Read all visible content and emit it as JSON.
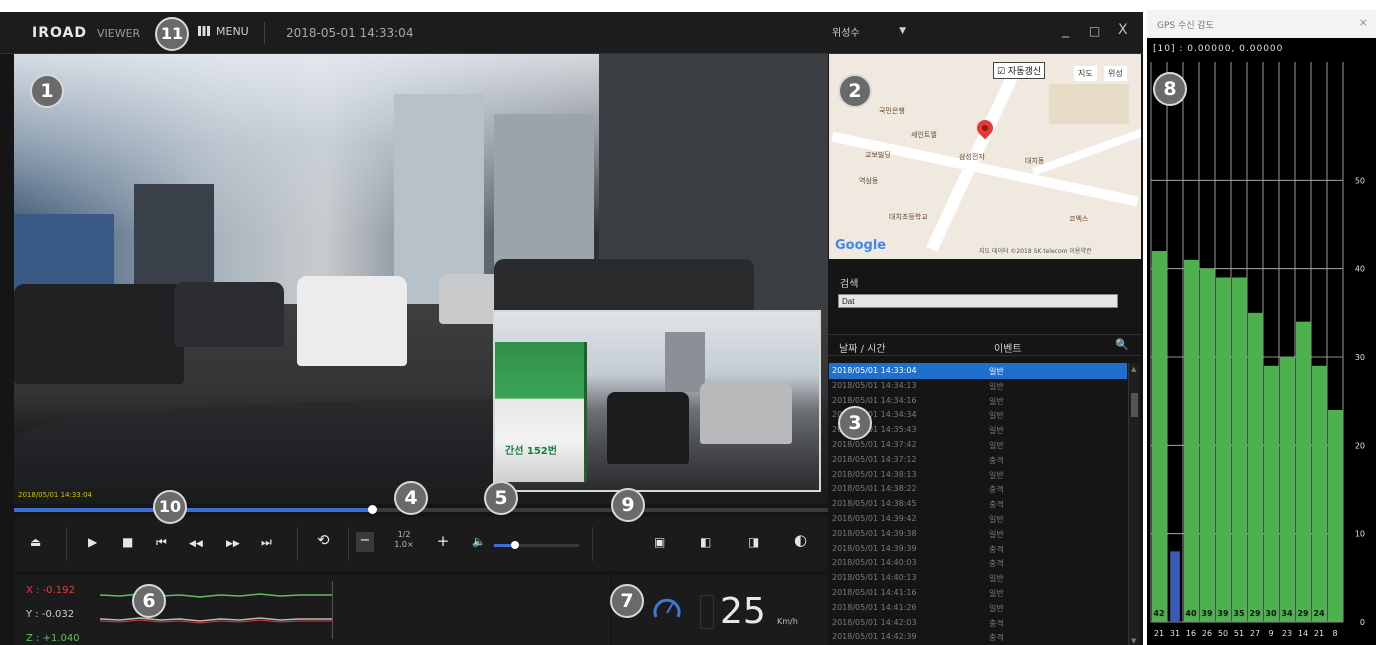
{
  "titlebar": {
    "logo": "IROAD",
    "logo_sub": "VIEWER",
    "menu_label": "MENU",
    "datetime": "2018-05-01 14:33:04",
    "gps_select": "위성수",
    "minimize": "_",
    "maximize": "□",
    "close": "X"
  },
  "video": {
    "stamp": "2018/05/01 14:33:04",
    "bus_label": "간선 152번"
  },
  "controls": {
    "eject": "⏏",
    "play": "▶",
    "stop": "■",
    "prev_file": "⏮",
    "rewind": "◀◀",
    "fast_forward": "▶▶",
    "next_file": "⏭",
    "repeat": "⟲",
    "speed_minus": "−",
    "speed_value_top": "1/2",
    "speed_value_bottom": "1.0×",
    "speed_plus": "+",
    "volume_icon": "🔈",
    "view_1": "▣",
    "view_2": "◧",
    "view_3": "◨",
    "brightness": "◐",
    "seek_progress": 0.44,
    "volume_level": 0.25
  },
  "sensor": {
    "x_label": "X : -0.192",
    "y_label": "Y : -0.032",
    "z_label": "Z : +1.040"
  },
  "speed": {
    "value": "25",
    "unit": "Km/h"
  },
  "map": {
    "auto_follow": "☑ 자동갱신",
    "map_btn": "지도",
    "satellite_btn": "위성",
    "google": "Google",
    "credit": "지도 데이터 ©2018 SK telecom  이용약관",
    "labels": [
      "국민은행",
      "세인트엘",
      "교보빌딩",
      "삼성전자",
      "대치동",
      "역삼동",
      "대치초등학교",
      "코엑스"
    ]
  },
  "search": {
    "label": "검색",
    "value": "Dat"
  },
  "list": {
    "header_date": "날짜 / 시간",
    "header_event": "이벤트",
    "search_icon": "🔍",
    "rows": [
      {
        "date": "2018/05/01 14:33:04",
        "event": "일반"
      },
      {
        "date": "2018/05/01 14:34:13",
        "event": "일반"
      },
      {
        "date": "2018/05/01 14:34:16",
        "event": "일반"
      },
      {
        "date": "2018/05/01 14:34:34",
        "event": "일반"
      },
      {
        "date": "2018/05/01 14:35:43",
        "event": "일반"
      },
      {
        "date": "2018/05/01 14:37:42",
        "event": "일반"
      },
      {
        "date": "2018/05/01 14:37:12",
        "event": "충격"
      },
      {
        "date": "2018/05/01 14:38:13",
        "event": "일반"
      },
      {
        "date": "2018/05/01 14:38:22",
        "event": "충격"
      },
      {
        "date": "2018/05/01 14:38:45",
        "event": "충격"
      },
      {
        "date": "2018/05/01 14:39:42",
        "event": "일반"
      },
      {
        "date": "2018/05/01 14:39:38",
        "event": "일반"
      },
      {
        "date": "2018/05/01 14:39:39",
        "event": "충격"
      },
      {
        "date": "2018/05/01 14:40:03",
        "event": "충격"
      },
      {
        "date": "2018/05/01 14:40:13",
        "event": "일반"
      },
      {
        "date": "2018/05/01 14:41:16",
        "event": "일반"
      },
      {
        "date": "2018/05/01 14:41:26",
        "event": "일반"
      },
      {
        "date": "2018/05/01 14:42:03",
        "event": "충격"
      },
      {
        "date": "2018/05/01 14:42:39",
        "event": "충격"
      }
    ]
  },
  "callouts": [
    "1",
    "2",
    "3",
    "4",
    "5",
    "6",
    "7",
    "8",
    "9",
    "10",
    "11"
  ],
  "gps": {
    "title": "GPS 수신 감도",
    "close": "×",
    "coords": "[10] : 0.00000, 0.00000"
  },
  "chart_data": {
    "type": "bar",
    "title": "GPS 수신 감도",
    "ylim": [
      0,
      60
    ],
    "yticks": [
      0,
      10,
      20,
      30,
      40,
      50
    ],
    "categories": [
      "42",
      "21",
      "40",
      "39",
      "39",
      "35",
      "29",
      "30",
      "34",
      "20",
      "24"
    ],
    "top_values": [
      "",
      "",
      "",
      "",
      "",
      "",
      "",
      "",
      "",
      "",
      ""
    ],
    "bottom_labels": [
      "21",
      "31",
      "16",
      "26",
      "50",
      "51",
      "27",
      "9",
      "23",
      "14",
      "21",
      "8"
    ],
    "values": [
      42,
      8,
      41,
      40,
      39,
      39,
      35,
      29,
      30,
      34,
      29,
      24
    ],
    "bar_colors": [
      "#4db24d",
      "#3a5bb8",
      "#4db24d",
      "#4db24d",
      "#4db24d",
      "#4db24d",
      "#4db24d",
      "#4db24d",
      "#4db24d",
      "#4db24d",
      "#4db24d",
      "#4db24d"
    ],
    "bar_labels": [
      "42",
      "",
      "40",
      "39",
      "39",
      "35",
      "29",
      "30",
      "34",
      "29",
      "24",
      ""
    ],
    "grid": true,
    "colors": {
      "good": "#4db24d",
      "weak": "#3a5bb8",
      "background": "#000000"
    }
  }
}
